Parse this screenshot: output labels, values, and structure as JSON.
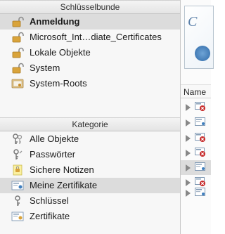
{
  "keychains": {
    "header": "Schlüsselbunde",
    "items": [
      {
        "label": "Anmeldung",
        "icon": "lock-open-icon",
        "bold": true,
        "selected": true
      },
      {
        "label": "Microsoft_Int…diate_Certificates",
        "icon": "lock-open-icon",
        "bold": false,
        "selected": false
      },
      {
        "label": "Lokale Objekte",
        "icon": "lock-open-icon",
        "bold": false,
        "selected": false
      },
      {
        "label": "System",
        "icon": "lock-open-icon",
        "bold": false,
        "selected": false
      },
      {
        "label": "System-Roots",
        "icon": "certificate-folder-icon",
        "bold": false,
        "selected": false
      }
    ]
  },
  "category": {
    "header": "Kategorie",
    "items": [
      {
        "label": "Alle Objekte",
        "icon": "keys-icon",
        "selected": false
      },
      {
        "label": "Passwörter",
        "icon": "password-keys-icon",
        "selected": false
      },
      {
        "label": "Sichere Notizen",
        "icon": "note-icon",
        "selected": false
      },
      {
        "label": "Meine Zertifikate",
        "icon": "my-certificate-icon",
        "selected": true
      },
      {
        "label": "Schlüssel",
        "icon": "key-icon",
        "selected": false
      },
      {
        "label": "Zertifikate",
        "icon": "certificate-icon",
        "selected": false
      }
    ]
  },
  "list": {
    "column_name": "Name",
    "rows": [
      {
        "status": "invalid"
      },
      {
        "status": "valid"
      },
      {
        "status": "invalid"
      },
      {
        "status": "invalid"
      },
      {
        "status": "valid",
        "selected": true
      },
      {
        "status": "invalid"
      },
      {
        "status": "valid"
      }
    ]
  },
  "colors": {
    "selection": "#dcdcdc",
    "lock": "#d9a33a",
    "error": "#c62828"
  }
}
